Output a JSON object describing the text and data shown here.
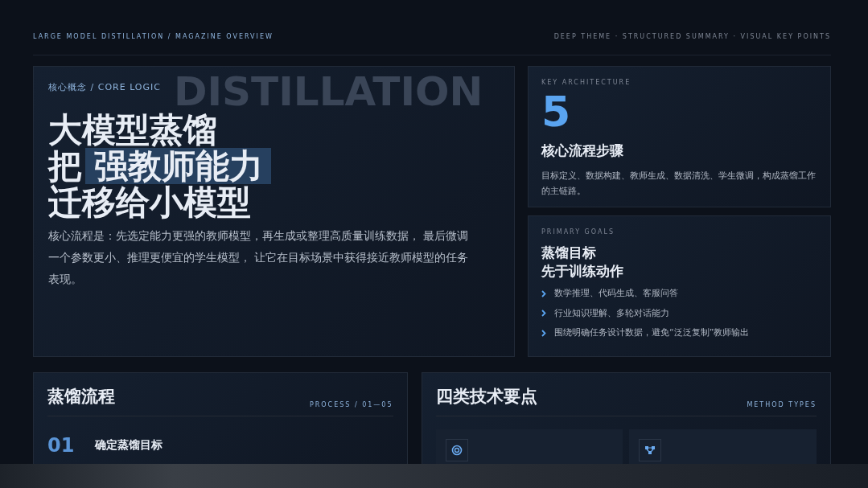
{
  "header": {
    "left": "LARGE MODEL DISTILLATION / MAGAZINE OVERVIEW",
    "right": "DEEP THEME · STRUCTURED SUMMARY · VISUAL KEY POINTS"
  },
  "hero": {
    "backdrop": "DISTILLATION",
    "eyebrow": "核心概念 / CORE LOGIC",
    "title_lines": [
      {
        "text": "大模型蒸馏",
        "highlighted": false
      },
      {
        "text": "把 强教师能力",
        "highlighted": true
      },
      {
        "text": "迁移给小模型",
        "highlighted": false
      }
    ],
    "lead": "核心流程是：先选定能力更强的教师模型，再生成或整理高质量训练数据， 最后微调一个参数更小、推理更便宜的学生模型， 让它在目标场景中获得接近教师模型的任务表现。"
  },
  "architecture": {
    "eyebrow": "KEY ARCHITECTURE",
    "number": "5",
    "title": "核心流程步骤",
    "text": "目标定义、数据构建、教师生成、数据清洗、学生微调，构成蒸馏工作的主链路。"
  },
  "goals": {
    "eyebrow": "PRIMARY GOALS",
    "title_lines": [
      "蒸馏目标",
      "先于训练动作"
    ],
    "items": [
      "数学推理、代码生成、客服问答",
      "行业知识理解、多轮对话能力",
      "围绕明确任务设计数据，避免“泛泛复制”教师输出"
    ]
  },
  "process": {
    "title": "蒸馏流程",
    "tag": "PROCESS / 01—05",
    "steps": [
      {
        "number": "01",
        "title": "确定蒸馏目标"
      }
    ]
  },
  "methods": {
    "title": "四类技术要点",
    "tag": "METHOD TYPES",
    "cards": [
      {
        "kind": "target"
      },
      {
        "kind": "network"
      }
    ]
  }
}
